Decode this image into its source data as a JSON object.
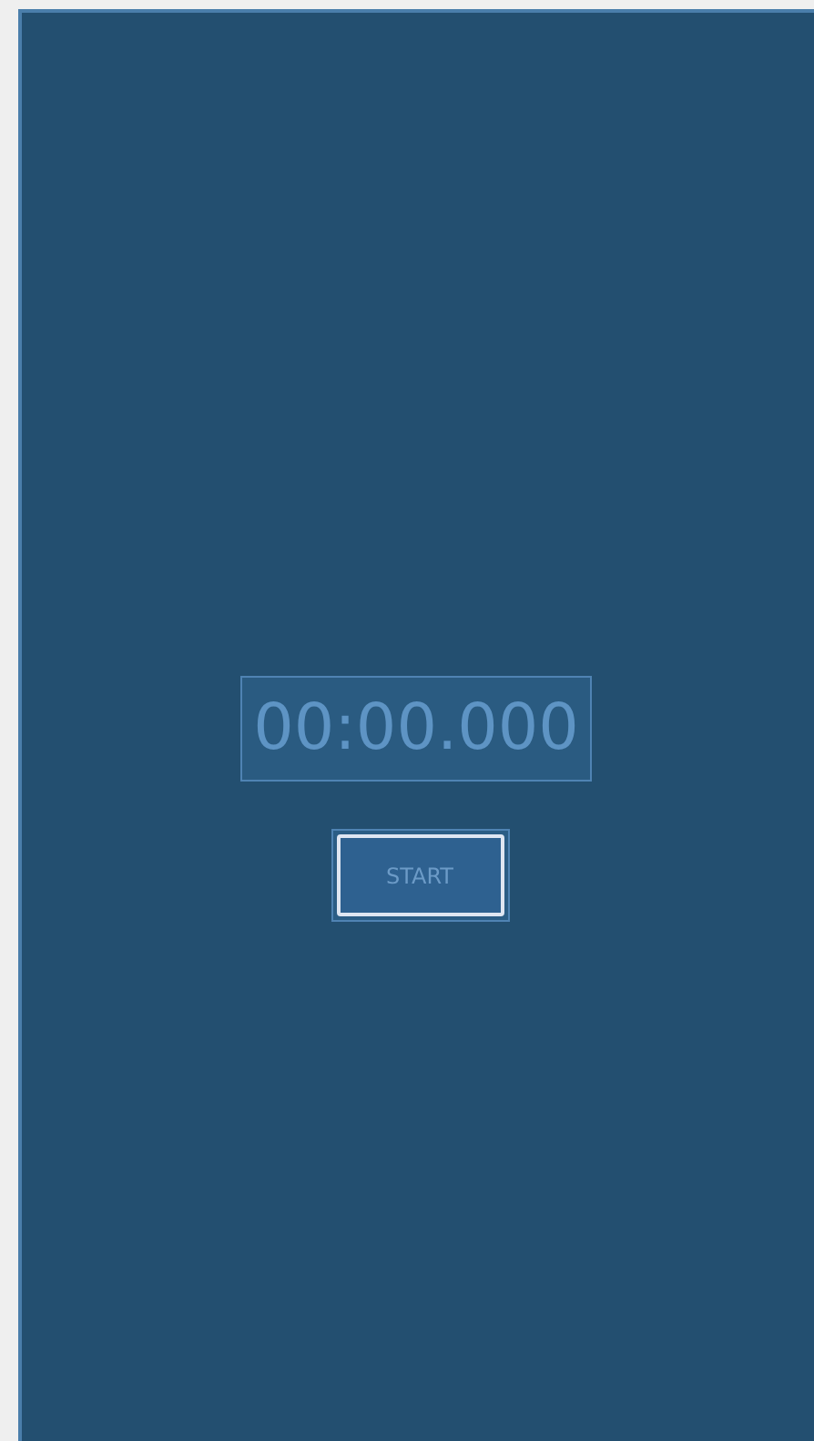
{
  "timer": {
    "display": "00:00.000"
  },
  "button": {
    "label": "START"
  }
}
